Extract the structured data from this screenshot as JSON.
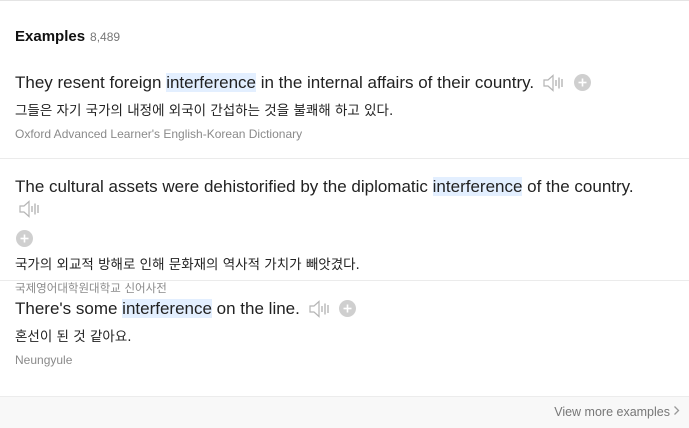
{
  "header": {
    "title": "Examples",
    "count": "8,489"
  },
  "examples": [
    {
      "before": "They resent foreign ",
      "highlight": "interference",
      "after": " in the internal affairs of their country.",
      "translation": "그들은 자기 국가의 내정에 외국이 간섭하는 것을 불쾌해 하고 있다.",
      "source": "Oxford Advanced Learner's English-Korean Dictionary"
    },
    {
      "before": "The cultural assets were dehistorified by the diplomatic ",
      "highlight": "interference",
      "after": " of the country.",
      "translation": "국가의 외교적 방해로 인해 문화재의 역사적 가치가 빼앗겼다.",
      "source": "국제영어대학원대학교 신어사전"
    },
    {
      "before": "There's some ",
      "highlight": "interference",
      "after": " on the line.",
      "translation": "혼선이 된 것 같아요.",
      "source": "Neungyule"
    }
  ],
  "footer": {
    "view_more": "View more examples"
  },
  "icons": {
    "audio": "speaker-icon",
    "add": "plus-circle-icon",
    "more": "chevron-right-icon"
  },
  "colors": {
    "highlight": "#e3efff",
    "icon_gray": "#b5b5b5",
    "source_gray": "#8a8a8a"
  }
}
